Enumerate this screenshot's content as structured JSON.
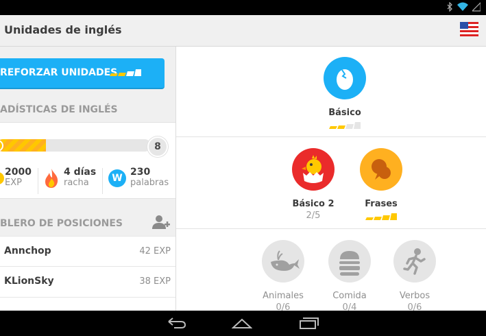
{
  "app": {
    "title": "Unidades de inglés",
    "flag_icon": "us-flag-icon"
  },
  "colors": {
    "blue": "#1cb0f6",
    "gold": "#ffc800",
    "red": "#ea2b2b",
    "gray_bg": "#f0f0f0"
  },
  "left": {
    "reinforce_label": "REFORZAR UNIDADES",
    "stats_heading": "ADÍSTICAS DE INGLÉS",
    "level_next": "8",
    "level_progress": 0.32,
    "stats": [
      {
        "value": "2000",
        "unit": "EXP",
        "icon": "xp-icon"
      },
      {
        "value": "4 días",
        "unit": "racha",
        "icon": "flame-icon"
      },
      {
        "value": "230",
        "unit": "palabras",
        "icon": "words-icon"
      }
    ],
    "words_badge": "W",
    "leaderboard_heading": "BLERO DE POSICIONES",
    "leaderboard": [
      {
        "name": "Annchop",
        "xp": "42 EXP"
      },
      {
        "name": "KLionSky",
        "xp": "38 EXP"
      }
    ]
  },
  "skills": {
    "basico": {
      "name": "Básico",
      "strength": 2
    },
    "basico2": {
      "name": "Básico 2",
      "progress": "2/5"
    },
    "frases": {
      "name": "Frases",
      "strength": 4
    },
    "locked": [
      {
        "name": "Animales",
        "progress": "0/6",
        "icon": "whale-icon"
      },
      {
        "name": "Comida",
        "progress": "0/4",
        "icon": "burger-icon"
      },
      {
        "name": "Verbos",
        "progress": "0/6",
        "icon": "runner-icon"
      }
    ]
  }
}
